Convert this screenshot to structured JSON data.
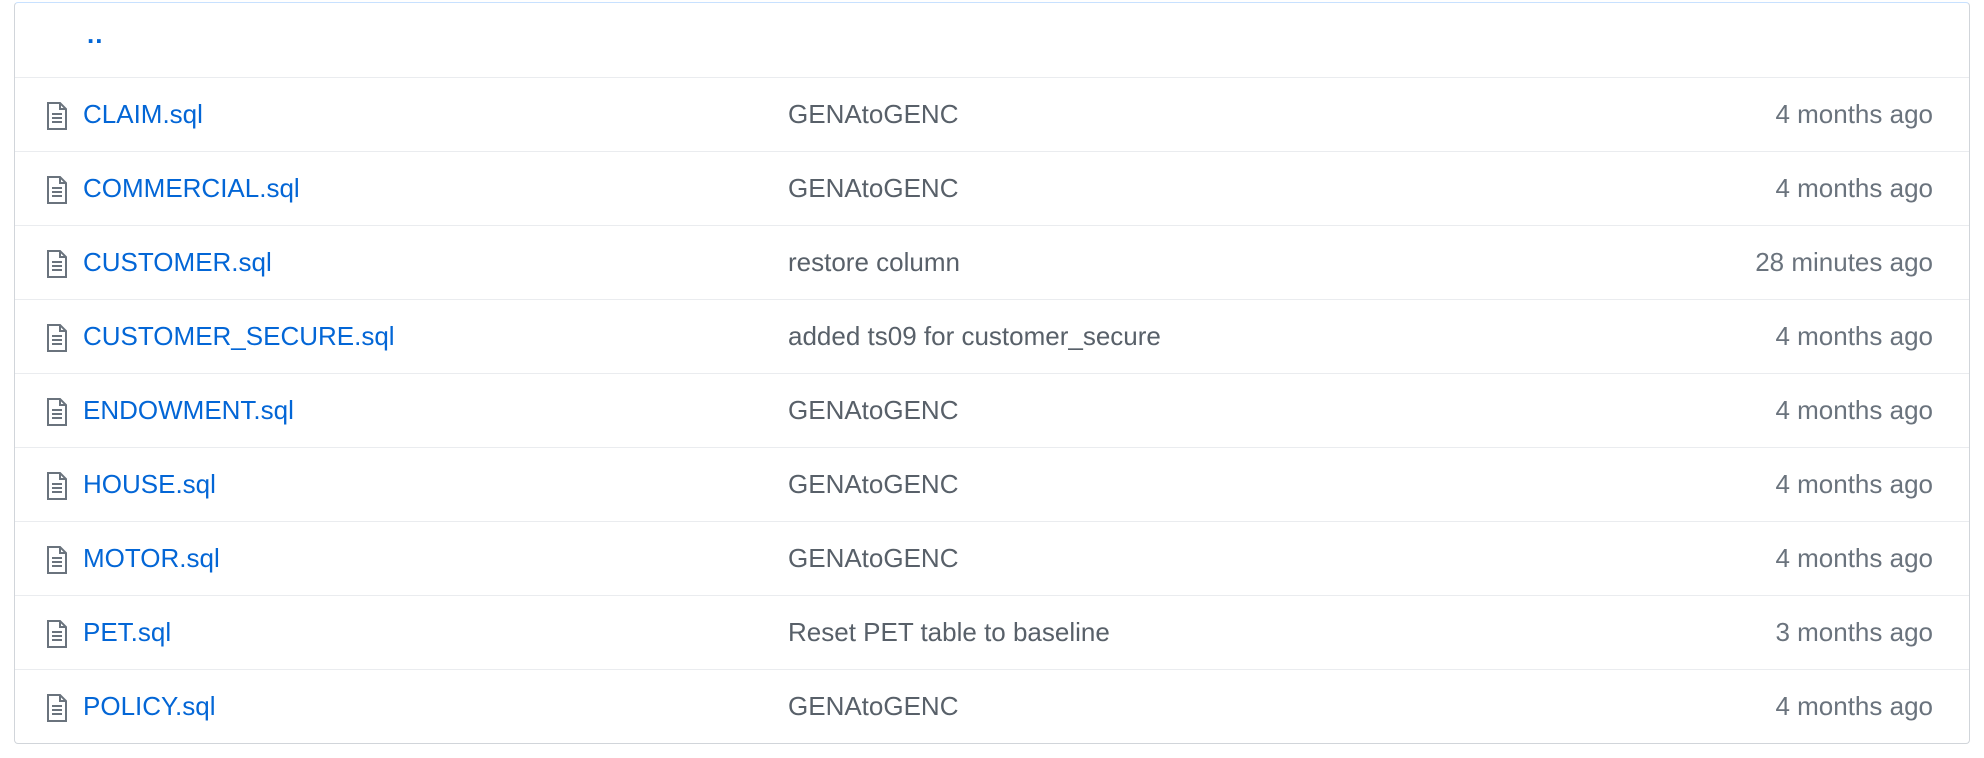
{
  "file_list": {
    "parent_link": "..",
    "files": [
      {
        "name": "CLAIM.sql",
        "message": "GENAtoGENC",
        "age": "4 months ago",
        "icon": "file-text-icon"
      },
      {
        "name": "COMMERCIAL.sql",
        "message": "GENAtoGENC",
        "age": "4 months ago",
        "icon": "file-text-icon"
      },
      {
        "name": "CUSTOMER.sql",
        "message": "restore column",
        "age": "28 minutes ago",
        "icon": "file-text-icon"
      },
      {
        "name": "CUSTOMER_SECURE.sql",
        "message": "added ts09 for customer_secure",
        "age": "4 months ago",
        "icon": "file-text-icon"
      },
      {
        "name": "ENDOWMENT.sql",
        "message": "GENAtoGENC",
        "age": "4 months ago",
        "icon": "file-text-icon"
      },
      {
        "name": "HOUSE.sql",
        "message": "GENAtoGENC",
        "age": "4 months ago",
        "icon": "file-text-icon"
      },
      {
        "name": "MOTOR.sql",
        "message": "GENAtoGENC",
        "age": "4 months ago",
        "icon": "file-text-icon"
      },
      {
        "name": "PET.sql",
        "message": "Reset PET table to baseline",
        "age": "3 months ago",
        "icon": "file-text-icon"
      },
      {
        "name": "POLICY.sql",
        "message": "GENAtoGENC",
        "age": "4 months ago",
        "icon": "file-text-icon"
      }
    ]
  },
  "colors": {
    "link": "#0366d6",
    "message_text": "#586069",
    "age_text": "#6a737d",
    "row_border": "#eaecef",
    "icon": "#6a737d"
  }
}
